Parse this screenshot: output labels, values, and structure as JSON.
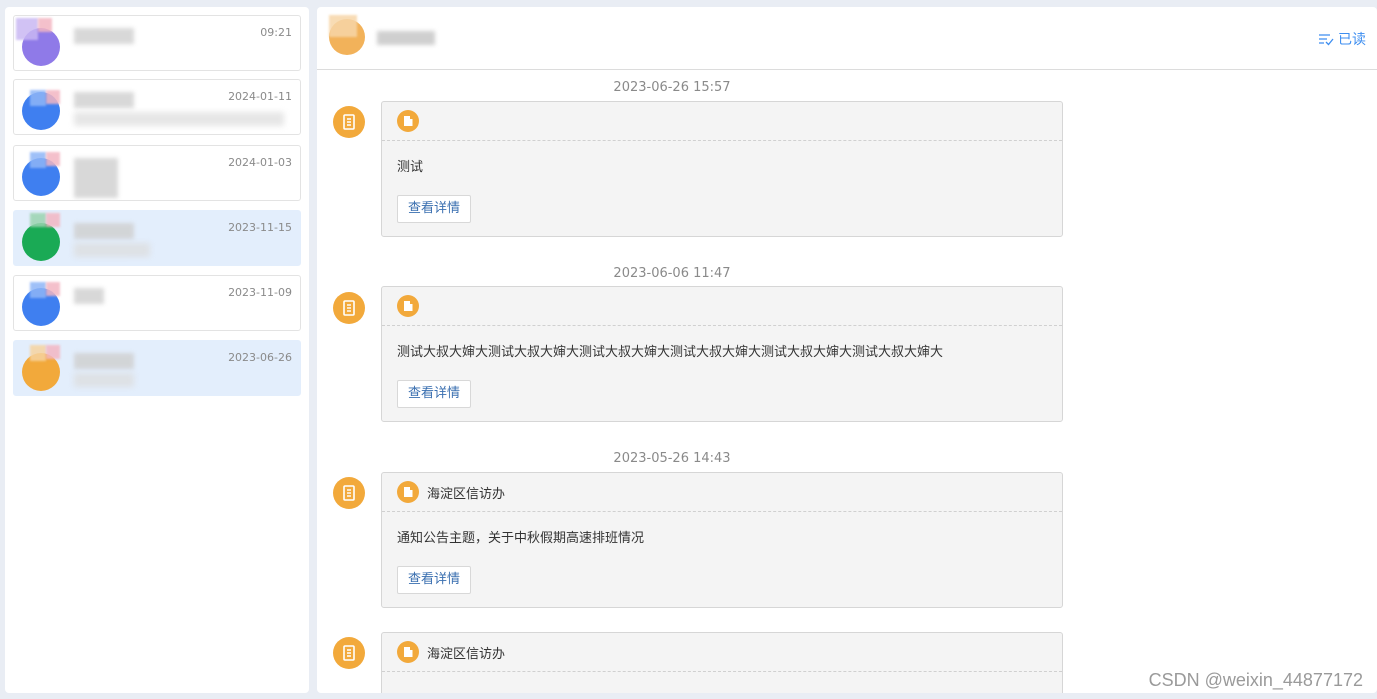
{
  "sidebar": {
    "conversations": [
      {
        "time": "09:21",
        "active": false
      },
      {
        "time": "2024-01-11",
        "active": false
      },
      {
        "time": "2024-01-03",
        "active": false
      },
      {
        "time": "2023-11-15",
        "active": true
      },
      {
        "time": "2023-11-09",
        "active": false
      },
      {
        "time": "2023-06-26",
        "active": true
      }
    ]
  },
  "header": {
    "mark_read_label": "已读",
    "mark_read_icon": "mark-read-icon"
  },
  "messages": [
    {
      "time": "2023-06-26 15:57",
      "source": "",
      "text": "测试",
      "detail_label": "查看详情"
    },
    {
      "time": "2023-06-06 11:47",
      "source": "",
      "text": "测试大叔大婶大测试大叔大婶大测试大叔大婶大测试大叔大婶大测试大叔大婶大测试大叔大婶大",
      "detail_label": "查看详情"
    },
    {
      "time": "2023-05-26 14:43",
      "source": "海淀区信访办",
      "text": "通知公告主题，关于中秋假期高速排班情况",
      "detail_label": "查看详情"
    },
    {
      "time": "",
      "source": "海淀区信访办",
      "text": "",
      "detail_label": ""
    }
  ],
  "colors": {
    "accent_blue": "#3d8ef0",
    "bot_orange": "#f2a93b",
    "active_row": "#e3eefc"
  },
  "watermark": "CSDN @weixin_44877172"
}
